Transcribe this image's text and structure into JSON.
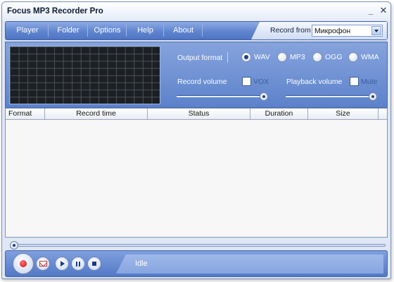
{
  "window": {
    "title": "Focus MP3 Recorder Pro"
  },
  "menu": {
    "items": [
      "Player",
      "Folder",
      "Options",
      "Help",
      "About"
    ]
  },
  "record_from": {
    "label": "Record from",
    "value": "Микрофон"
  },
  "output_format": {
    "label": "Output format",
    "options": [
      "WAV",
      "MP3",
      "OGG",
      "WMA"
    ],
    "selected": "WAV"
  },
  "record_volume": {
    "label": "Record volume",
    "vox_label": "VOX",
    "vox_checked": false,
    "level_percent": 95
  },
  "playback_volume": {
    "label": "Playback volume",
    "mute_label": "Mute",
    "mute_checked": false,
    "level_percent": 95
  },
  "table": {
    "columns": [
      "Format",
      "Record time",
      "Status",
      "Duration",
      "Size"
    ],
    "rows": []
  },
  "status": {
    "text": "Idle"
  },
  "icons": {
    "minimize": "minimize-icon",
    "close": "close-icon",
    "record": "record-icon",
    "email": "email-icon",
    "play": "play-icon",
    "pause": "pause-icon",
    "stop": "stop-icon"
  },
  "colors": {
    "accent": "#5f84cf",
    "record": "#d60000"
  }
}
